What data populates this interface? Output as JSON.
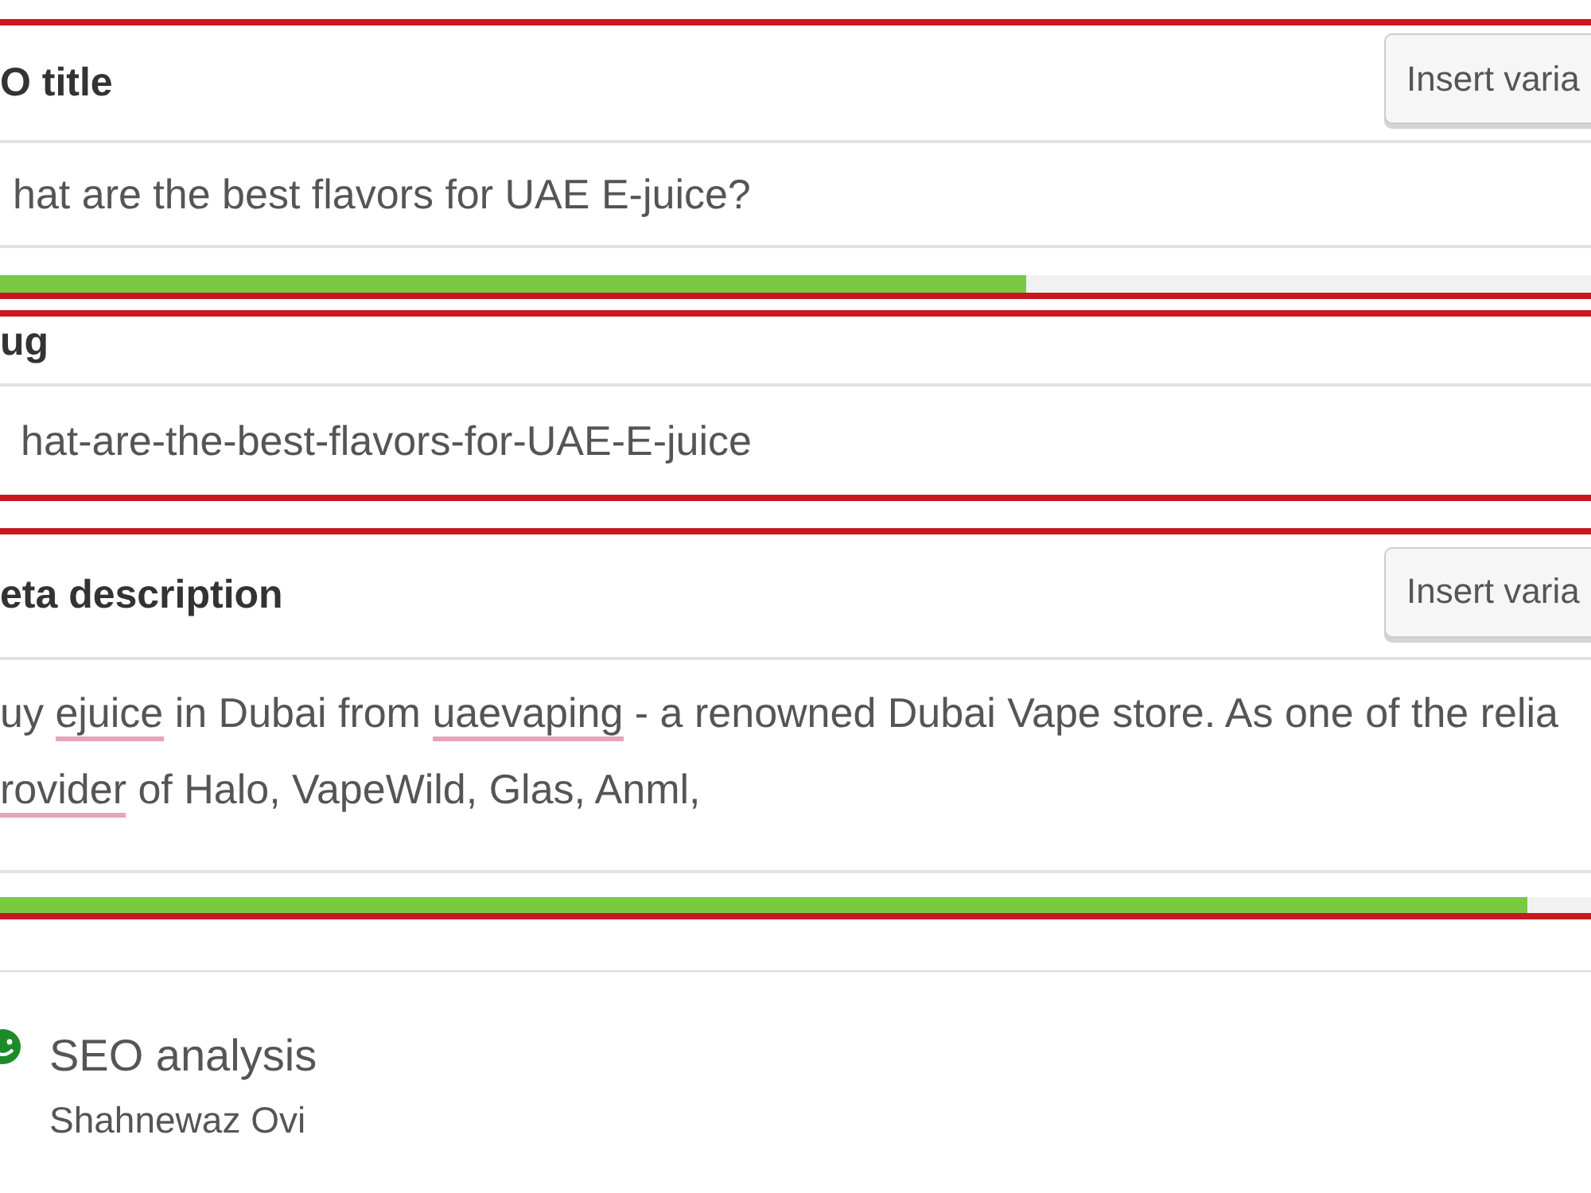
{
  "seo_title": {
    "label": "O title",
    "highlighted": true,
    "insert_button": "Insert varia",
    "value": "hat are the best flavors for UAE E-juice?",
    "level": 0.645
  },
  "slug": {
    "label": "ug",
    "highlighted": true,
    "value": "hat-are-the-best-flavors-for-UAE-E-juice"
  },
  "meta_description": {
    "label": "eta description",
    "highlighted": true,
    "insert_button": "Insert varia",
    "lines": [
      [
        {
          "text": "uy ",
          "misspelled": false
        },
        {
          "text": "ejuice",
          "misspelled": true
        },
        {
          "text": " in Dubai from ",
          "misspelled": false
        },
        {
          "text": "uaevaping",
          "misspelled": true
        },
        {
          "text": " - a renowned Dubai Vape store. As one of the relia",
          "misspelled": false
        }
      ],
      [
        {
          "text": "rovider",
          "misspelled": true
        },
        {
          "text": " of Halo, VapeWild, Glas, Anml,",
          "misspelled": false
        }
      ]
    ],
    "level": 0.96
  },
  "seo_analysis": {
    "title": "SEO analysis",
    "keyphrase": "Shahnewaz Ovi"
  }
}
